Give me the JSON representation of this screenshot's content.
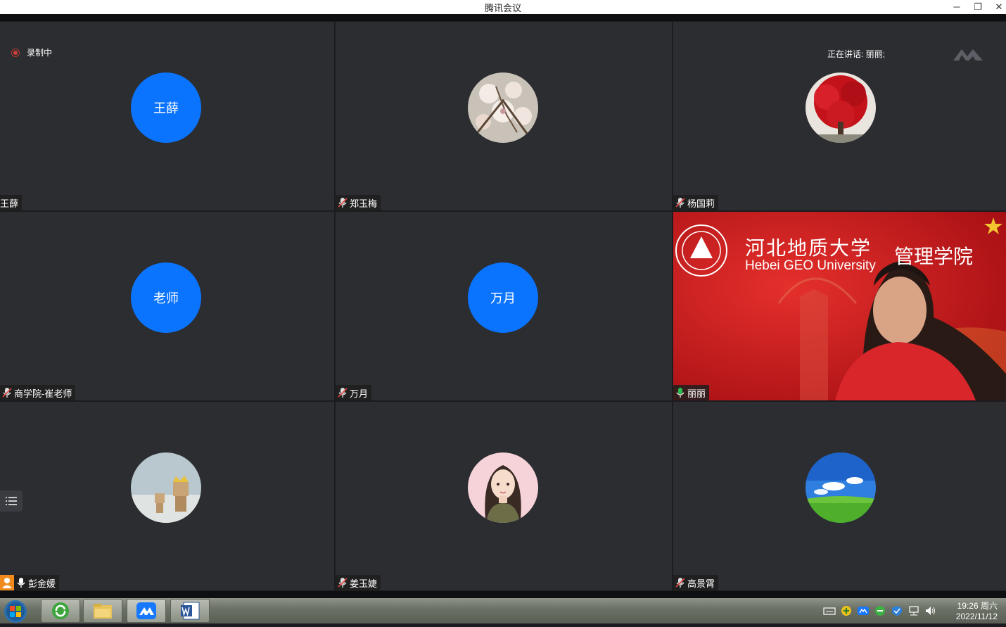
{
  "window": {
    "title": "腾讯会议",
    "minimize": "─",
    "restore": "❐",
    "close": "✕"
  },
  "status": {
    "recording": "录制中",
    "speaking": "正在讲话: 丽丽;"
  },
  "participants": [
    {
      "name": "王薛",
      "avatar_text": "王薛",
      "avatar": "text"
    },
    {
      "name": "郑玉梅",
      "avatar": "magnolia-photo"
    },
    {
      "name": "杨国莉",
      "avatar": "red-tree-photo"
    },
    {
      "name": "商学院-崔老师",
      "avatar_text": "老师",
      "avatar": "text"
    },
    {
      "name": "万月",
      "avatar_text": "万月",
      "avatar": "text"
    },
    {
      "name": "丽丽",
      "avatar": "live-video"
    },
    {
      "name": "彭金媛",
      "avatar": "toy-figures-photo"
    },
    {
      "name": "姜玉婕",
      "avatar": "girl-illustration"
    },
    {
      "name": "高景霄",
      "avatar": "sky-meadow-photo"
    }
  ],
  "video_background": {
    "university_cn": "河北地质大学",
    "university_en": "Hebei GEO University",
    "school": "管理学院"
  },
  "taskbar": {
    "time": "19:26 周六",
    "date": "2022/11/12"
  },
  "colors": {
    "tile_bg": "#2b2d31",
    "avatar_blue": "#0b74ff",
    "recording_red": "#d0413c",
    "speaking_green": "#2bbf4c"
  }
}
